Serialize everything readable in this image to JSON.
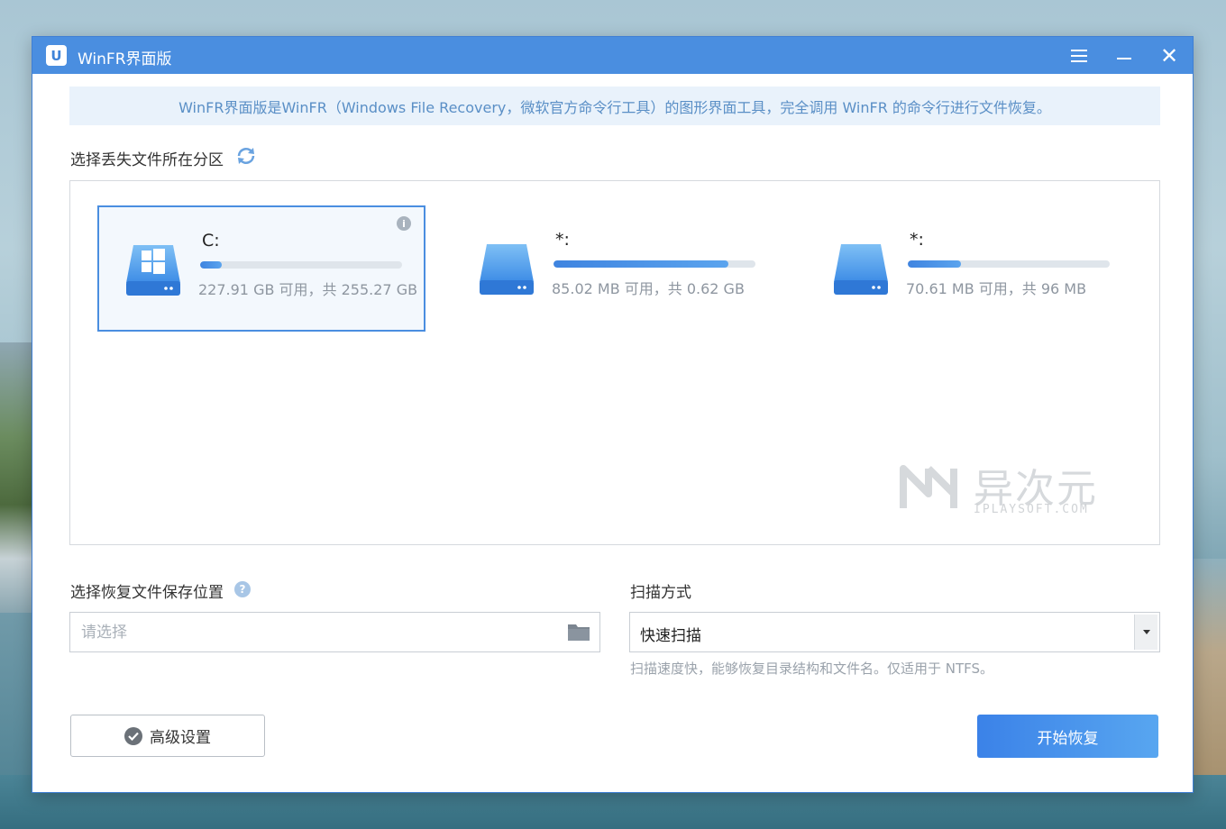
{
  "window": {
    "title": "WinFR界面版",
    "app_icon_glyph": "U",
    "controls": [
      "menu-icon",
      "minimize-icon",
      "close-icon"
    ]
  },
  "banner": {
    "text": "WinFR界面版是WinFR（Windows File Recovery，微软官方命令行工具）的图形界面工具，完全调用 WinFR 的命令行进行文件恢复。"
  },
  "partition": {
    "label": "选择丢失文件所在分区",
    "drives": [
      {
        "name": "C:",
        "size_text": "227.91 GB 可用，共 255.27 GB",
        "used_fraction": 0.107,
        "selected": true,
        "icon": "windows-drive-icon"
      },
      {
        "name": "*:",
        "size_text": "85.02 MB 可用，共 0.62 GB",
        "used_fraction": 0.866,
        "selected": false,
        "icon": "drive-icon"
      },
      {
        "name": "*:",
        "size_text": "70.61 MB 可用，共 96 MB",
        "used_fraction": 0.264,
        "selected": false,
        "icon": "drive-icon"
      }
    ]
  },
  "watermark": {
    "text": "异次元",
    "sub": "IPLAYSOFT.COM"
  },
  "save_location": {
    "label": "选择恢复文件保存位置",
    "placeholder": "请选择",
    "value": ""
  },
  "scan": {
    "label": "扫描方式",
    "selected": "快速扫描",
    "hint": "扫描速度快，能够恢复目录结构和文件名。仅适用于 NTFS。"
  },
  "buttons": {
    "advanced": "高级设置",
    "start": "开始恢复"
  },
  "colors": {
    "titlebar": "#4a8ee0",
    "accent": "#3f84e0",
    "banner_bg": "#e9f2fb",
    "banner_text": "#5a8fc6"
  }
}
